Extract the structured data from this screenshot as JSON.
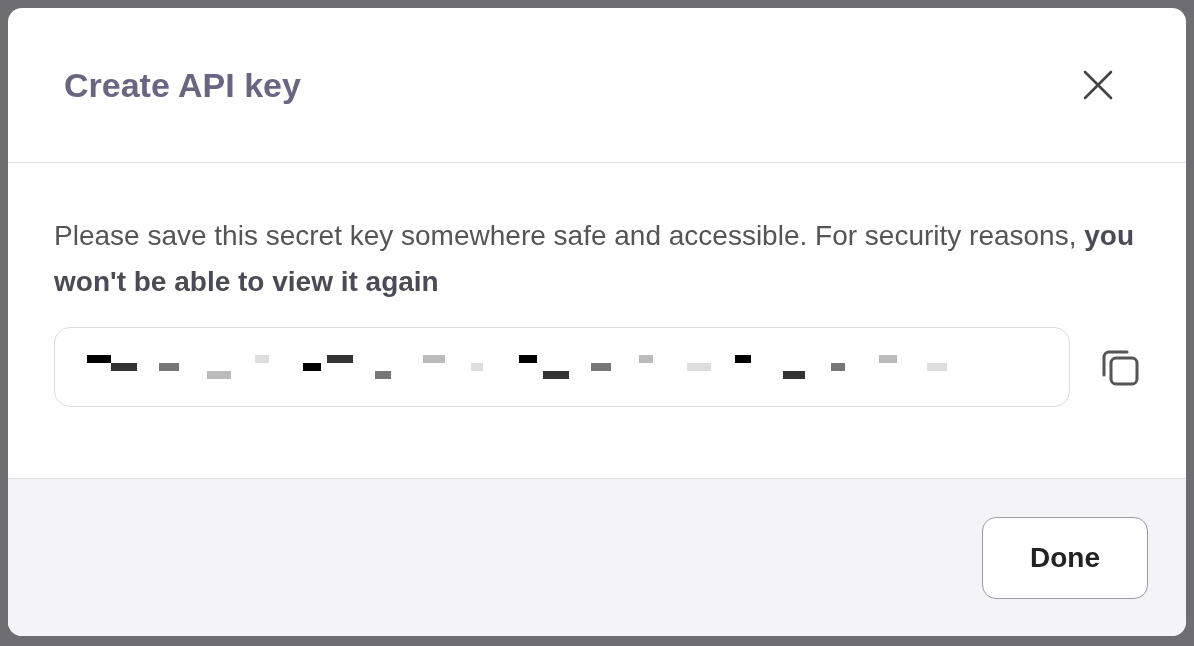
{
  "dialog": {
    "title": "Create API key",
    "message": "Please save this secret key somewhere safe and accessible. For security reasons, **you won't be able to view it again**",
    "buttons": [
      {
        "label": "Done"
      }
    ]
  }
}
